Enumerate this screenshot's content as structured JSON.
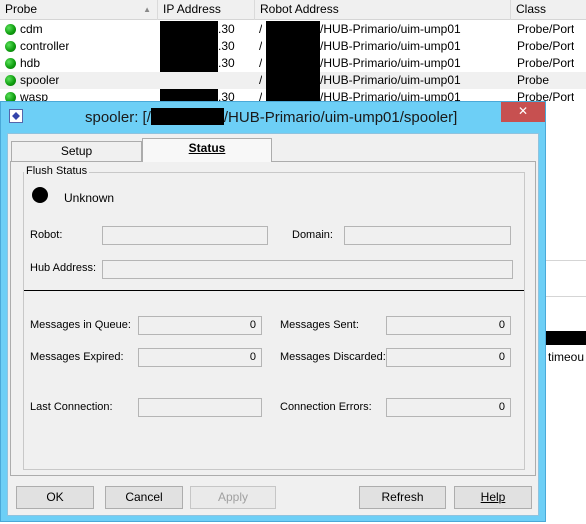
{
  "probe_list": {
    "columns": [
      {
        "label": "Probe"
      },
      {
        "label": "IP Address"
      },
      {
        "label": "Robot Address"
      },
      {
        "label": "Class"
      }
    ],
    "rows": [
      {
        "name": "cdm",
        "ip_suffix": ".30",
        "robot": "/HUB-Primario/uim-ump01",
        "class": "Probe/Port",
        "status": "green"
      },
      {
        "name": "controller",
        "ip_suffix": ".30",
        "robot": "/HUB-Primario/uim-ump01",
        "class": "Probe/Port",
        "status": "green"
      },
      {
        "name": "hdb",
        "ip_suffix": ".30",
        "robot": "/HUB-Primario/uim-ump01",
        "class": "Probe/Port",
        "status": "green"
      },
      {
        "name": "spooler",
        "ip_suffix": "",
        "robot": "/HUB-Primario/uim-ump01",
        "class": "Probe",
        "status": "green"
      },
      {
        "name": "wasp",
        "ip_suffix": ".30",
        "robot": "/HUB-Primario/uim-ump01",
        "class": "Probe/Port",
        "status": "green"
      }
    ],
    "right_strip_text": "timeou"
  },
  "dialog": {
    "title_prefix": "spooler: [/",
    "title_suffix": "/HUB-Primario/uim-ump01/spooler]",
    "close_glyph": "✕",
    "tabs": [
      {
        "label": "Setup",
        "active": false
      },
      {
        "label": "Status",
        "active": true
      }
    ],
    "flush_status": {
      "legend": "Flush Status",
      "state": "Unknown"
    },
    "fields": {
      "robot_label": "Robot:",
      "robot_value": "",
      "domain_label": "Domain:",
      "domain_value": "",
      "hub_label": "Hub Address:",
      "hub_value": ""
    },
    "stats": {
      "messages_in_queue_label": "Messages in Queue:",
      "messages_in_queue": "0",
      "messages_sent_label": "Messages Sent:",
      "messages_sent": "0",
      "messages_expired_label": "Messages Expired:",
      "messages_expired": "0",
      "messages_discarded_label": "Messages Discarded:",
      "messages_discarded": "0",
      "last_connection_label": "Last Connection:",
      "last_connection": "",
      "connection_errors_label": "Connection Errors:",
      "connection_errors": "0"
    },
    "buttons": {
      "ok": "OK",
      "cancel": "Cancel",
      "apply": "Apply",
      "refresh": "Refresh",
      "help": "Help"
    }
  },
  "colors": {
    "title_bar": "#6dcff6",
    "close_button": "#c75050",
    "status_ok": "#11a011"
  }
}
